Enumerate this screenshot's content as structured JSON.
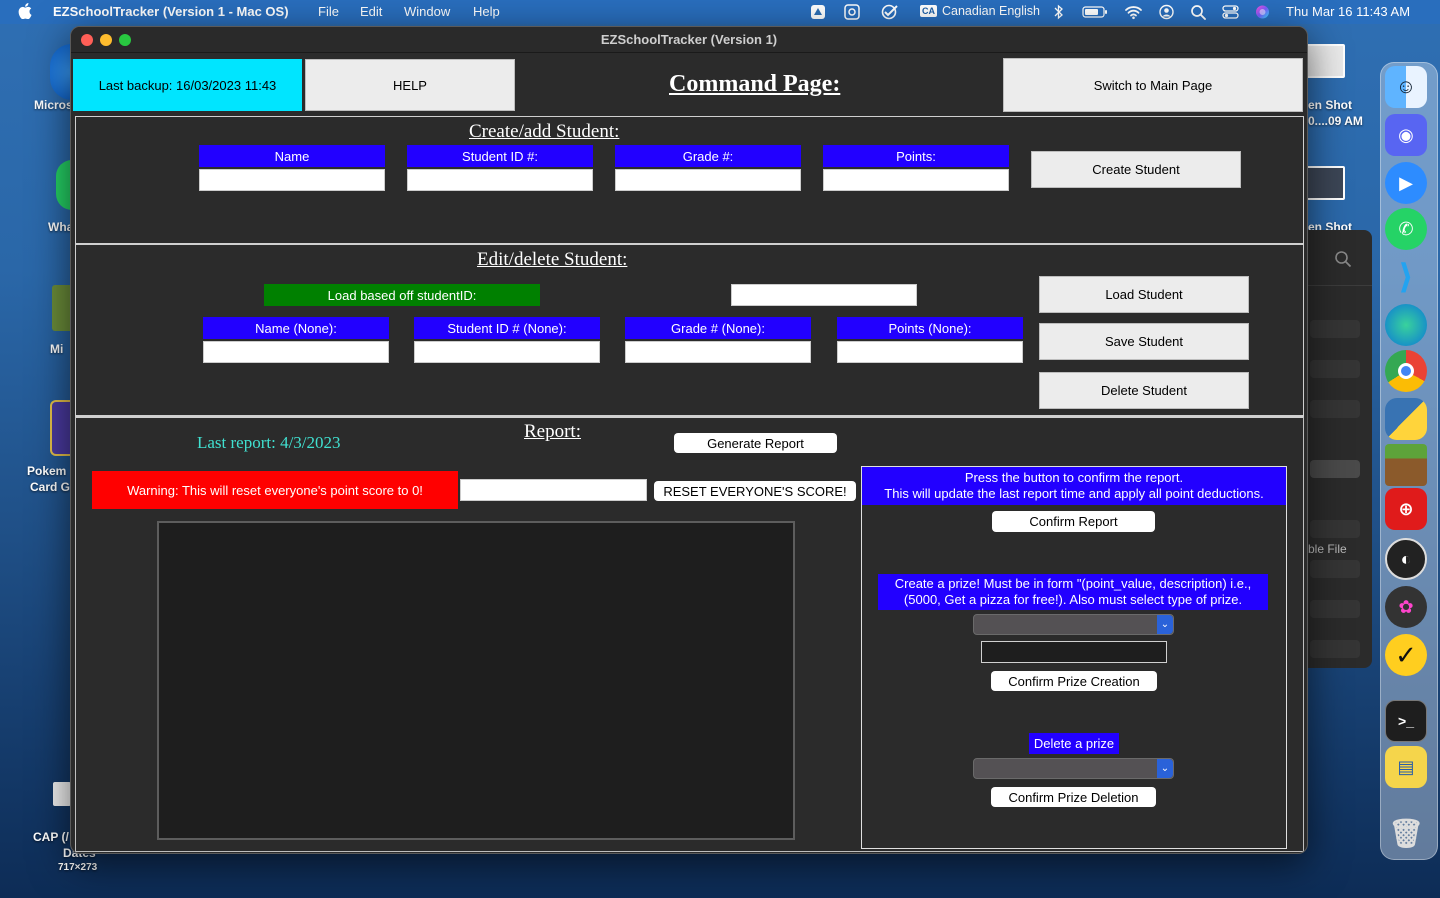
{
  "menubar": {
    "app_name": "EZSchoolTracker (Version 1 - Mac OS)",
    "menus": [
      "File",
      "Edit",
      "Window",
      "Help"
    ],
    "input_source": "Canadian English",
    "input_badge": "CA",
    "datetime": "Thu Mar 16  11:43 AM"
  },
  "desktop": {
    "labels": [
      "Micros",
      "Wha",
      "Mi",
      "Pokem",
      "Card G",
      "CAP (/",
      "Dates",
      "717×273",
      "en Shot",
      "0....09 AM",
      "en Shot",
      "ble File"
    ]
  },
  "window": {
    "title": "EZSchoolTracker (Version 1)"
  },
  "header": {
    "last_backup": "Last backup: 16/03/2023 11:43",
    "help_label": "HELP",
    "page_title": "Command Page:",
    "switch_label": "Switch to Main Page"
  },
  "create": {
    "title": "Create/add Student:",
    "fields": [
      "Name",
      "Student ID #:",
      "Grade #:",
      "Points:"
    ],
    "button": "Create Student"
  },
  "edit": {
    "title": "Edit/delete Student:",
    "load_label": "Load based off studentID:",
    "fields": [
      "Name (None):",
      "Student ID # (None):",
      "Grade # (None):",
      "Points (None):"
    ],
    "load_button": "Load Student",
    "save_button": "Save Student",
    "delete_button": "Delete Student"
  },
  "report": {
    "title": "Report:",
    "last_report": "Last report: 4/3/2023",
    "generate_button": "Generate Report",
    "warning": "Warning: This will reset everyone's point score to 0!",
    "reset_button": "RESET EVERYONE'S SCORE!",
    "confirm_text_line1": "Press the button to confirm the report.",
    "confirm_text_line2": "This will update the last report time and apply all point deductions.",
    "confirm_button": "Confirm Report",
    "prize_text_line1": "Create a prize! Must be in form \"(point_value, description) i.e.,",
    "prize_text_line2": "(5000, Get a pizza for free!).  Also must select type of prize.",
    "confirm_prize_button": "Confirm Prize Creation",
    "delete_prize_label": "Delete a prize",
    "confirm_delete_button": "Confirm Prize Deletion"
  },
  "colors": {
    "accent_blue": "#2200ff",
    "backup_cyan": "#00e5ff",
    "warning_red": "#ff0000",
    "load_green": "#008000",
    "report_teal": "#40e0d0"
  }
}
